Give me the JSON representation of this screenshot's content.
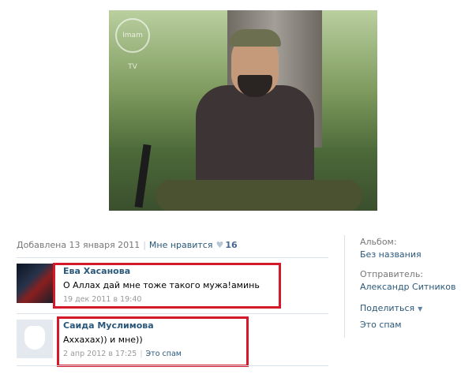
{
  "photo": {
    "watermark": "Imam TV"
  },
  "meta": {
    "added": "Добавлена 13 января 2011",
    "like_label": "Мне нравится",
    "likes": "16"
  },
  "comments": [
    {
      "author": "Ева Хасанова",
      "text": "О Аллах дай мне тоже такого мужа!аминь",
      "date": "19 дек 2011 в 19:40"
    },
    {
      "author": "Саида Муслимова",
      "text": "Аххахах)) и мне))",
      "date": "2 апр 2012 в 17:25",
      "spam": "Это спам"
    }
  ],
  "sidebar": {
    "album_label": "Альбом:",
    "album_value": "Без названия",
    "sender_label": "Отправитель:",
    "sender_value": "Александр Ситников",
    "share": "Поделиться",
    "spam": "Это спам"
  },
  "colors": {
    "link": "#2b587a",
    "highlight_box": "#d4192a"
  },
  "icons": [
    "heart-icon",
    "caret-down-icon"
  ]
}
